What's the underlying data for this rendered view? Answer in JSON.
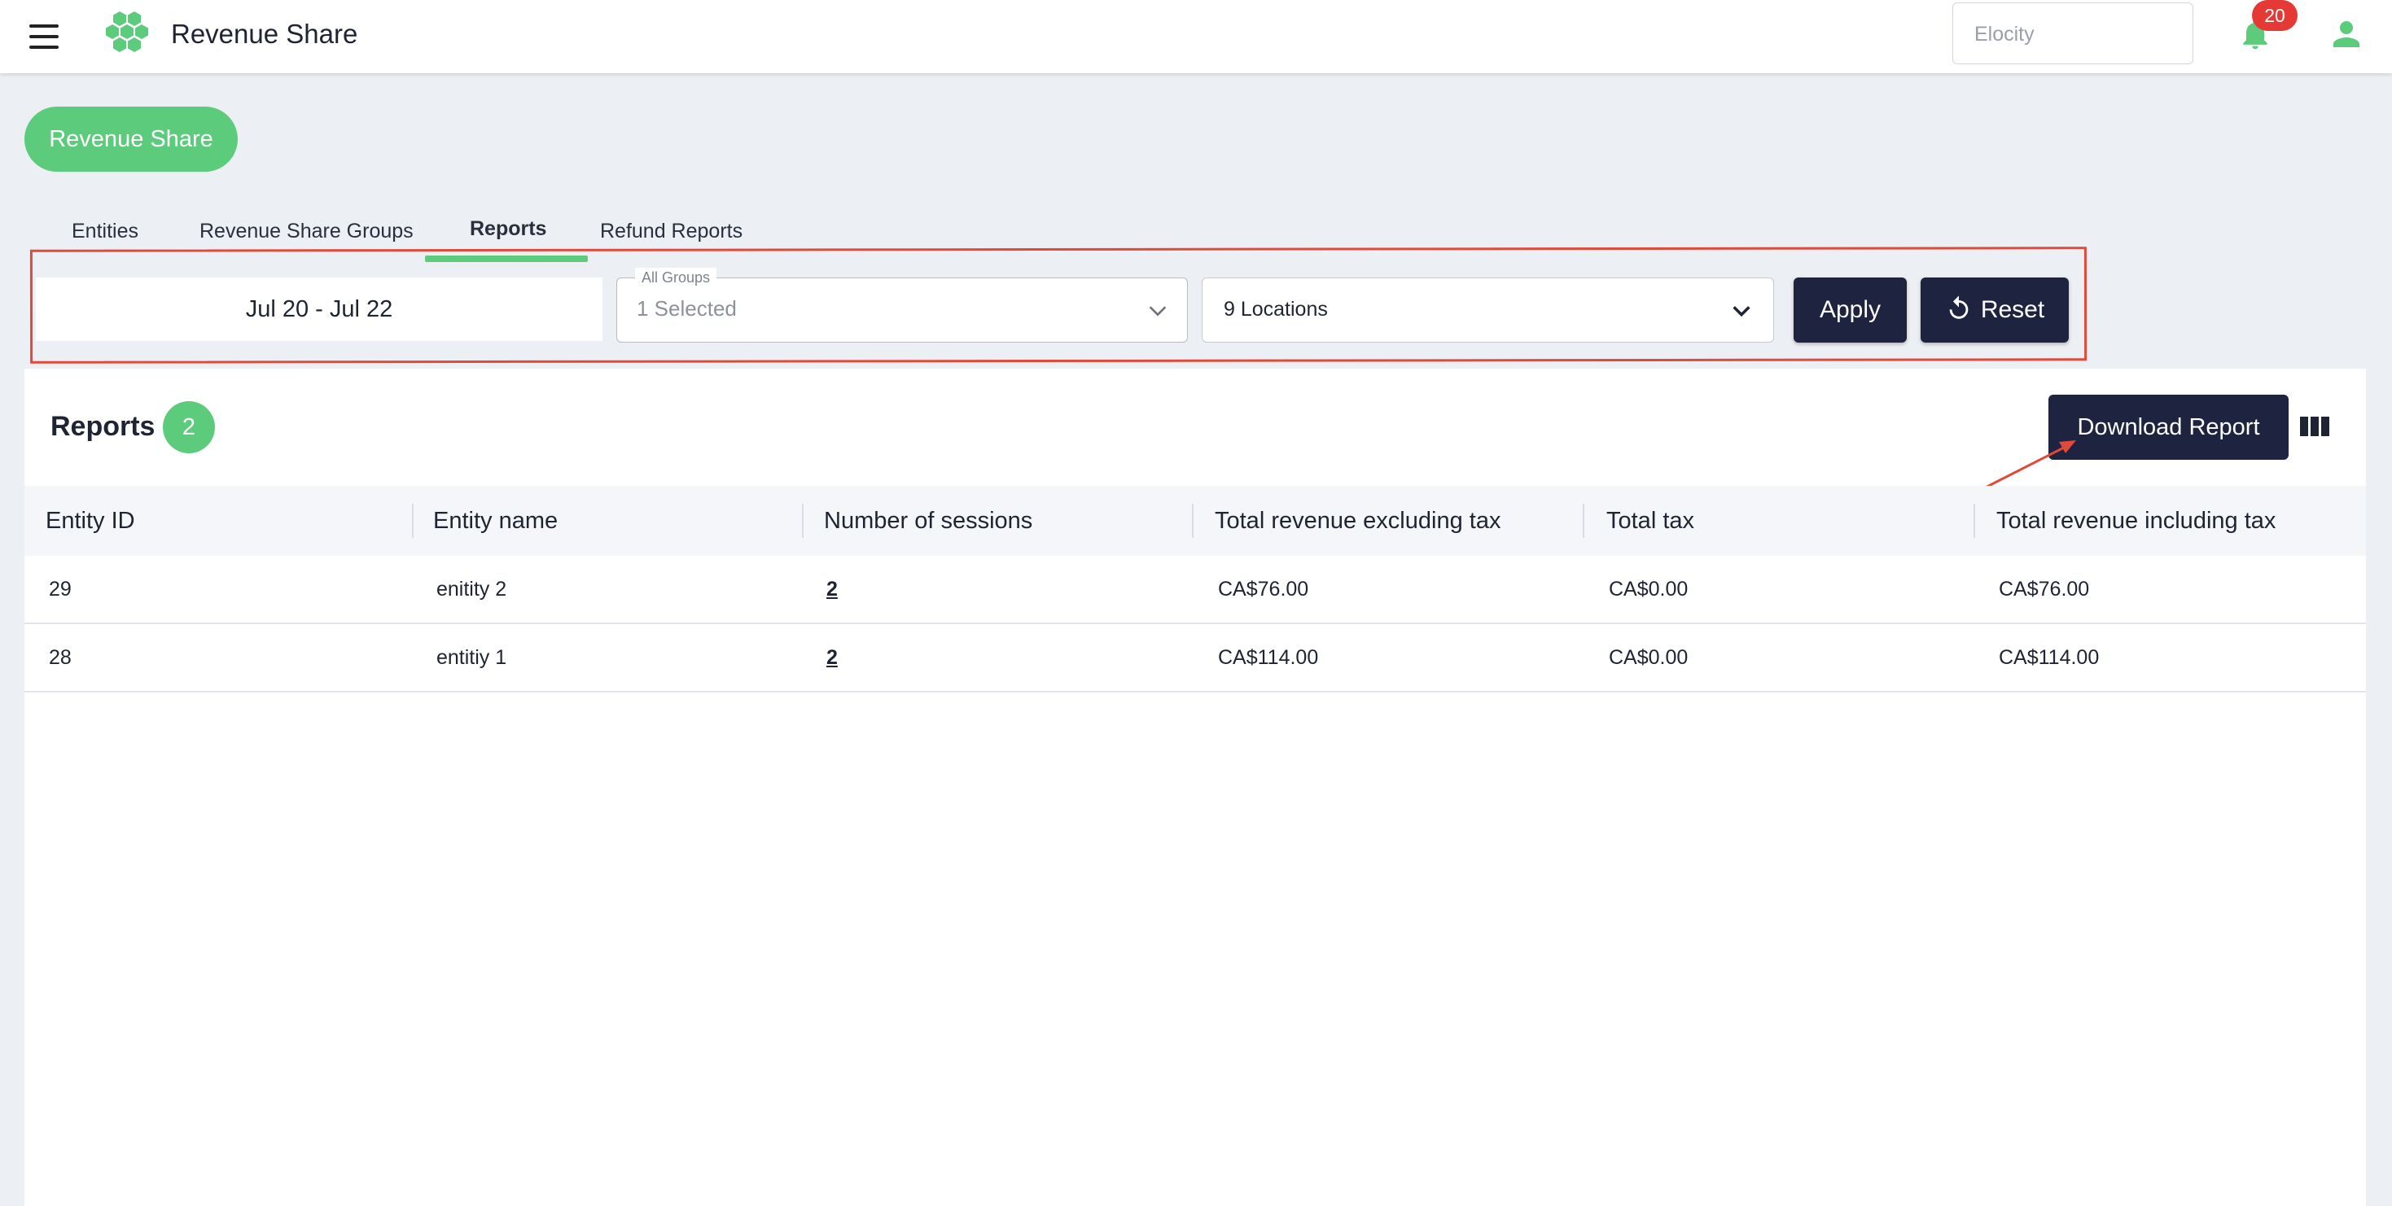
{
  "header": {
    "title": "Revenue Share",
    "org_select_value": "Elocity",
    "notification_count": "20",
    "icons": {
      "menu": "hamburger-menu-icon",
      "logo": "hexagon-cluster-logo",
      "bell": "bell-icon",
      "user": "user-icon"
    }
  },
  "page": {
    "pill_label": "Revenue Share"
  },
  "tabs": [
    {
      "label": "Entities",
      "active": false
    },
    {
      "label": "Revenue Share Groups",
      "active": false
    },
    {
      "label": "Reports",
      "active": true
    },
    {
      "label": "Refund Reports",
      "active": false
    }
  ],
  "filters": {
    "date_range": "Jul 20 - Jul 22",
    "groups_label": "All Groups",
    "groups_value": "1 Selected",
    "locations_value": "9 Locations",
    "apply_label": "Apply",
    "reset_label": "Reset"
  },
  "reports": {
    "title": "Reports",
    "count": "2",
    "download_label": "Download Report",
    "columns": [
      "Entity ID",
      "Entity name",
      "Number of sessions",
      "Total revenue excluding tax",
      "Total tax",
      "Total revenue including tax"
    ],
    "rows": [
      {
        "entity_id": "29",
        "entity_name": "enitity 2",
        "sessions": "2",
        "revenue_excl": "CA$76.00",
        "tax": "CA$0.00",
        "revenue_incl": "CA$76.00"
      },
      {
        "entity_id": "28",
        "entity_name": "entitiy 1",
        "sessions": "2",
        "revenue_excl": "CA$114.00",
        "tax": "CA$0.00",
        "revenue_incl": "CA$114.00"
      }
    ]
  },
  "colors": {
    "accent_green": "#5ccb7c",
    "dark_button": "#1e2440",
    "annotation_red": "#e04a3a",
    "badge_red": "#e53935"
  }
}
